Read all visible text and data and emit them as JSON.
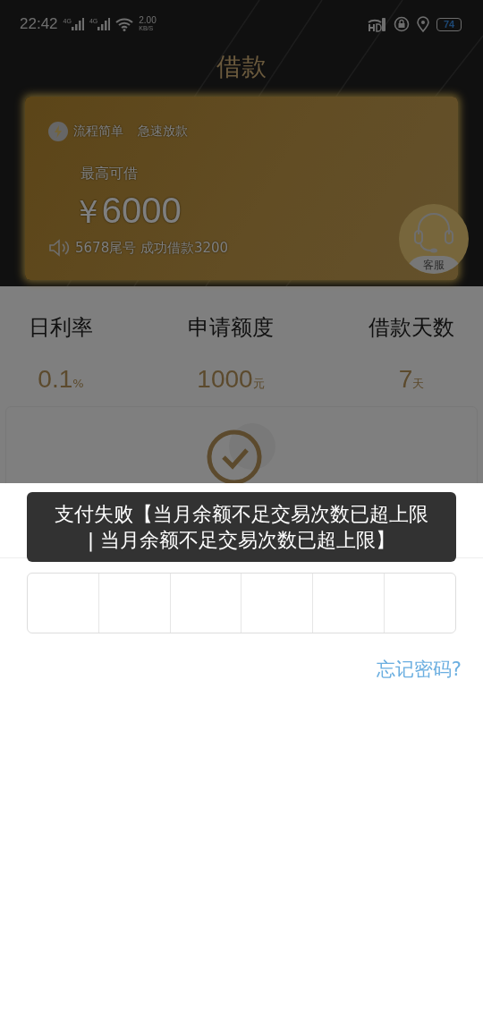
{
  "status_bar": {
    "time": "22:42",
    "networks": [
      "4G",
      "4G"
    ],
    "speed_value": "2.00",
    "speed_unit": "KB/S",
    "battery": "74"
  },
  "header": {
    "title": "借款"
  },
  "loan_card": {
    "features": [
      "流程简单",
      "急速放款"
    ],
    "limit_label": "最高可借",
    "currency": "¥",
    "amount": "6000",
    "notice": "5678尾号 成功借款3200",
    "service_label": "客服"
  },
  "stats": [
    {
      "label": "日利率",
      "value": "0.1",
      "unit": "%"
    },
    {
      "label": "申请额度",
      "value": "1000",
      "unit": "元"
    },
    {
      "label": "借款天数",
      "value": "7",
      "unit": "天"
    }
  ],
  "payment_sheet": {
    "toast": "支付失败【当月余额不足交易次数已超上限 | 当月余额不足交易次数已超上限】",
    "forgot_link": "忘记密码?"
  }
}
